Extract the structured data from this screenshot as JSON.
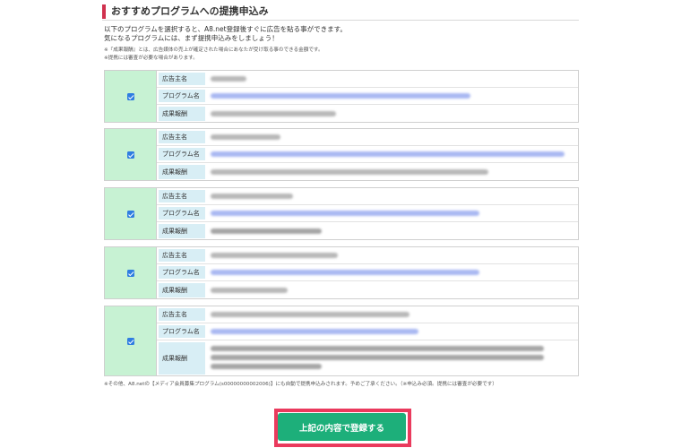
{
  "section": {
    "title": "おすすめプログラムへの提携申込み"
  },
  "intro": {
    "line1": "以下のプログラムを選択すると、A8.net登録後すぐに広告を貼る事ができます。",
    "line2": "気になるプログラムには、まず提携申込みをしましょう！"
  },
  "notes": {
    "line1": "※『成果報酬』とは、広告媒体の売上が確定された場合にあなたが受け取る事のできる金額です。",
    "line2": "※提携には審査が必要な場合があります。"
  },
  "labels": {
    "advertiser": "広告主名",
    "program": "プログラム名",
    "reward": "成果報酬"
  },
  "programs": [
    {
      "checked": true,
      "advertiser": "",
      "program": "",
      "reward": ""
    },
    {
      "checked": true,
      "advertiser": "",
      "program": "",
      "reward": ""
    },
    {
      "checked": true,
      "advertiser": "",
      "program": "",
      "reward": ""
    },
    {
      "checked": true,
      "advertiser": "",
      "program": "",
      "reward": ""
    },
    {
      "checked": true,
      "advertiser": "",
      "program": "",
      "reward": ""
    }
  ],
  "footer_note": "※その他、A8.netの【メディア会員募集プログラム(s00000000002006)】にも自動で提携申込みされます。予めご了承ください。（※申込み必須。提携には審査が必要です）",
  "submit": {
    "label": "上記の内容で登録する"
  },
  "colors": {
    "accent_red": "#ea3a5d",
    "button_green": "#1daf7a",
    "check_cell": "#c7f2d3",
    "label_cell": "#d8eef5",
    "checkbox": "#2f7de1"
  }
}
